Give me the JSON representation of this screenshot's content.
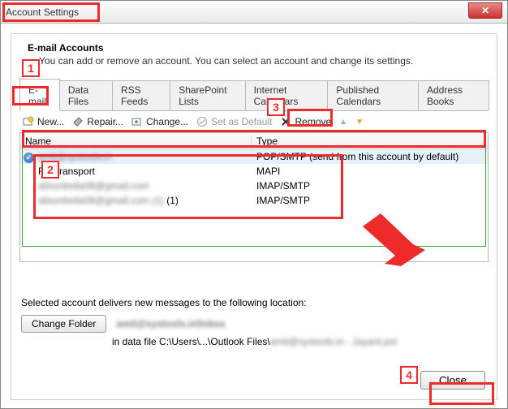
{
  "window": {
    "title": "Account Settings",
    "close_glyph": "✕"
  },
  "section": {
    "heading": "E-mail Accounts",
    "sub": "You can add or remove an account. You can select an account and change its settings."
  },
  "tabs": [
    {
      "label": "E-mail",
      "active": true
    },
    {
      "label": "Data Files"
    },
    {
      "label": "RSS Feeds"
    },
    {
      "label": "SharePoint Lists"
    },
    {
      "label": "Internet Calendars"
    },
    {
      "label": "Published Calendars"
    },
    {
      "label": "Address Books"
    }
  ],
  "toolbar": {
    "new": "New...",
    "repair": "Repair...",
    "change": "Change...",
    "set_default": "Set as Default",
    "remove": "Remove",
    "up_glyph": "▲",
    "down_glyph": "▼"
  },
  "columns": {
    "name": "Name",
    "type": "Type"
  },
  "accounts": [
    {
      "name_display": "amit@systools.in",
      "type": "POP/SMTP (send from this account by default)",
      "default": true,
      "selected": true,
      "blurred": true,
      "prefix": ""
    },
    {
      "name_display": "F        il Transport",
      "type": "MAPI",
      "default": false,
      "blurred": false,
      "prefix": "F"
    },
    {
      "name_display": "alisonbella08@gmail.com",
      "type": "IMAP/SMTP",
      "default": false,
      "blurred": true,
      "prefix": ""
    },
    {
      "name_display": "alisonbella08@gmail.com (1)",
      "type": "IMAP/SMTP",
      "default": false,
      "blurred": true,
      "prefix": ""
    }
  ],
  "bottom": {
    "delivers": "Selected account delivers new messages to the following location:",
    "change_folder": "Change Folder",
    "location_account": "amit@systools.in\\Inbox",
    "datafile_prefix": "in data file C:\\Users\\...\\Outlook Files\\",
    "datafile_blurred": "amit@systools.in - Jayant.pst"
  },
  "close_button": "Close",
  "annotations": {
    "n1": "1",
    "n2": "2",
    "n3": "3",
    "n4": "4"
  }
}
